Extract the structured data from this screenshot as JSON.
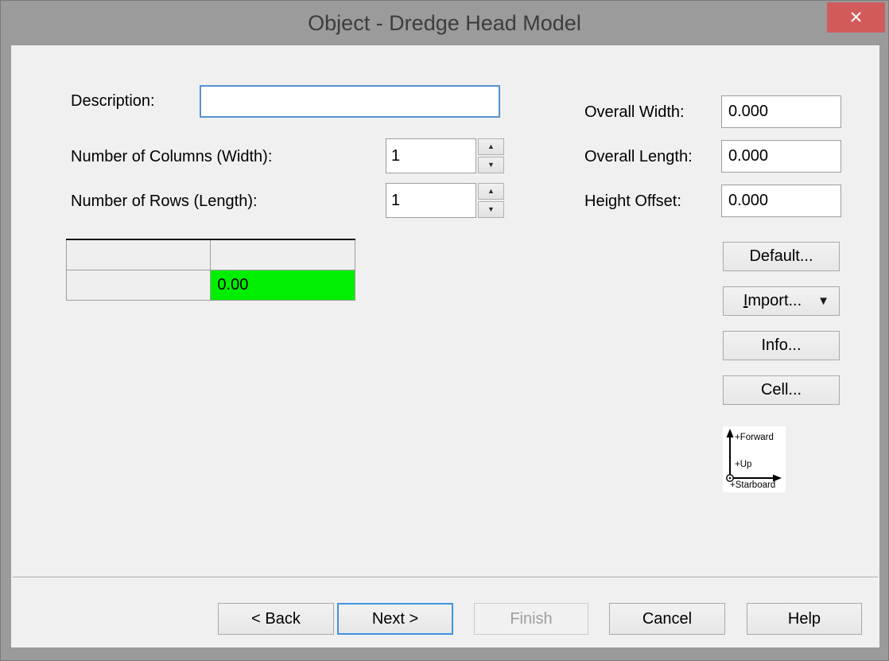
{
  "window": {
    "title": "Object - Dredge Head Model"
  },
  "icons": {
    "close": "✕",
    "spinner_up": "▲",
    "spinner_down": "▼",
    "import_dropdown": "▼"
  },
  "form": {
    "description": {
      "label": "Description:",
      "value": ""
    },
    "columns": {
      "label": "Number of Columns (Width):",
      "value": "1"
    },
    "rows": {
      "label": "Number of Rows (Length):",
      "value": "1"
    },
    "overall_width": {
      "label": "Overall Width:",
      "value": "0.000"
    },
    "overall_length": {
      "label": "Overall Length:",
      "value": "0.000"
    },
    "height_offset": {
      "label": "Height Offset:",
      "value": "0.000"
    }
  },
  "grid": {
    "cells": [
      [
        "",
        ""
      ],
      [
        "",
        "0.00"
      ]
    ],
    "selected_cell": {
      "row": 1,
      "col": 1,
      "value": "0.00",
      "highlight_color": "#00ee00"
    }
  },
  "side_buttons": {
    "default": "Default...",
    "import_accel": "I",
    "import_rest": "mport...",
    "info": "Info...",
    "cell": "Cell..."
  },
  "axis_diagram": {
    "forward_label": "+Forward",
    "up_label": "+Up",
    "starboard_label": "+Starboard"
  },
  "wizard": {
    "back": "< Back",
    "next": "Next >",
    "finish": "Finish",
    "cancel": "Cancel",
    "help": "Help"
  },
  "colors": {
    "titlebar": "#9b9b9b",
    "close_button": "#d15a5a",
    "content_bg": "#f0f0f0",
    "focused_input_border": "#5692d2",
    "next_button_border": "#4193e2",
    "selected_cell_green": "#00ee00"
  }
}
